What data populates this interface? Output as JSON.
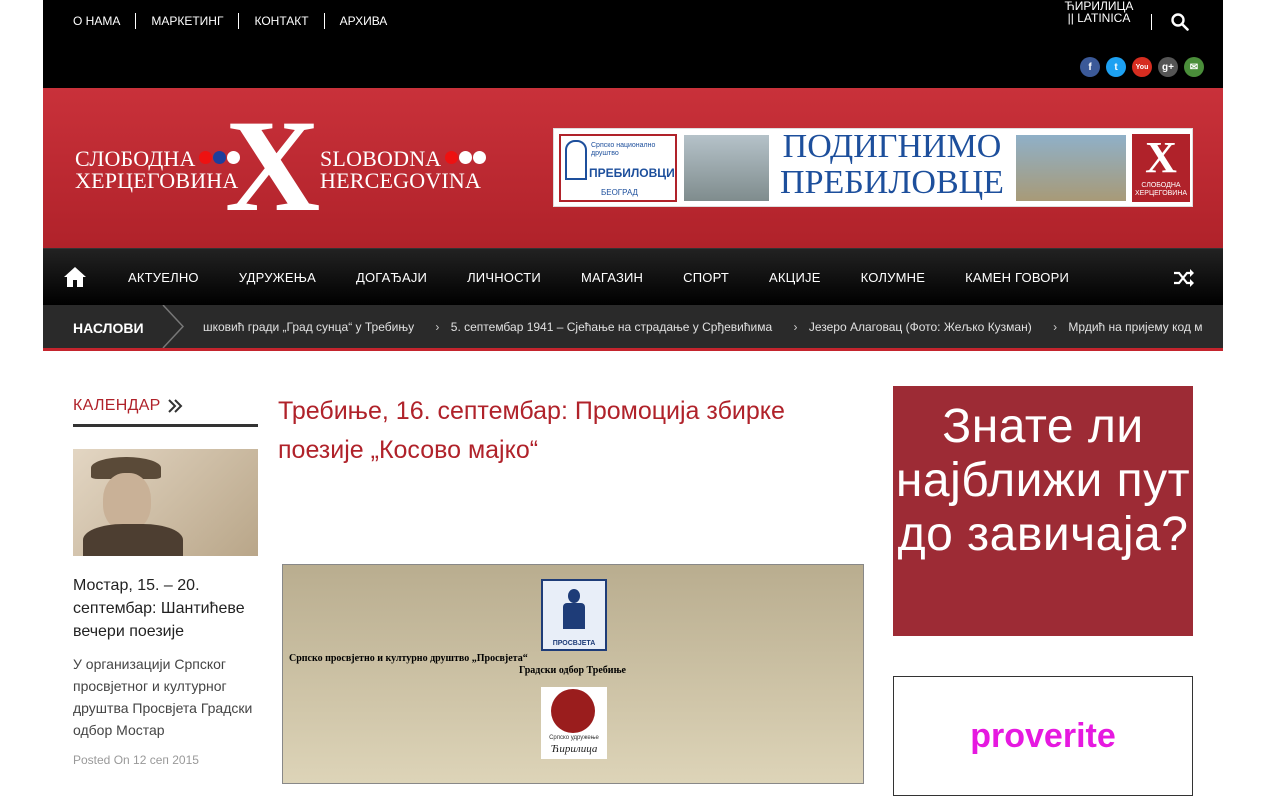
{
  "topnav": [
    "О НАМА",
    "МАРКЕТИНГ",
    "КОНТАКТ",
    "АРХИВА"
  ],
  "lang": {
    "cyr": "ЋИРИЛИЦА",
    "lat": "|| LATINICA"
  },
  "social": [
    "f",
    "t",
    "You",
    "g+",
    "✉"
  ],
  "logo": {
    "cyr1": "СЛОБОДНА",
    "cyr2": "ХЕРЦЕГОВИНА",
    "x": "X",
    "lat1": "SLOBODNA",
    "lat2": "HERCEGOVINA"
  },
  "banner": {
    "text": "ПОДИГНИМО ПРЕБИЛОВЦЕ",
    "left_small": "Српско национално друштво",
    "left_big": "ПРЕБИЛОВЦИ",
    "left_city": "БЕОГРАД",
    "x": "X",
    "x_small": "СЛОБОДНА ХЕРЦЕГОВИНА"
  },
  "mainnav": [
    "АКТУЕЛНО",
    "УДРУЖЕЊА",
    "ДОГАЂАЈИ",
    "ЛИЧНОСТИ",
    "МАГАЗИН",
    "СПОРТ",
    "АКЦИЈЕ",
    "КОЛУМНЕ",
    "КАМЕН ГОВОРИ"
  ],
  "ticker": {
    "label": "НАСЛОВИ",
    "items": [
      "шковић гради „Град сунца“ у Требињу",
      "5. септембар 1941 – Сјећање на страдање у Срђевићима",
      "Језеро Алаговац (Фото: Жељко Кузман)",
      "Мрдић на пријему код м"
    ]
  },
  "calendar": {
    "title": "КАЛЕНДАР",
    "article_title": "Мостар, 15. – 20. септембар: Шантићеве вечери поезије",
    "excerpt": "  У организацији Српског просвјетног и културног друштва Просвјета Градски одбор Мостар",
    "meta": "Posted On 12 сеп 2015"
  },
  "article": {
    "title": "Требиње, 16. септембар: Промоција збирке поезије „Косово мајко“",
    "poster_line1": "Српско просвјетно и културно друштво „Просвјета“",
    "poster_line2": "Градски одбор Требиње",
    "poster_logo1": "ПРОСВЈЕТА",
    "poster_logo2_small": "Српско удружење",
    "poster_logo2": "Ћирилица"
  },
  "ads": {
    "ad1": "Знате ли најближи пут до завичаја?",
    "ad2": "proverite"
  },
  "colors": {
    "brand_red": "#b0222a",
    "ad_red": "#9d2b35",
    "ad2_text": "#e619e0"
  }
}
